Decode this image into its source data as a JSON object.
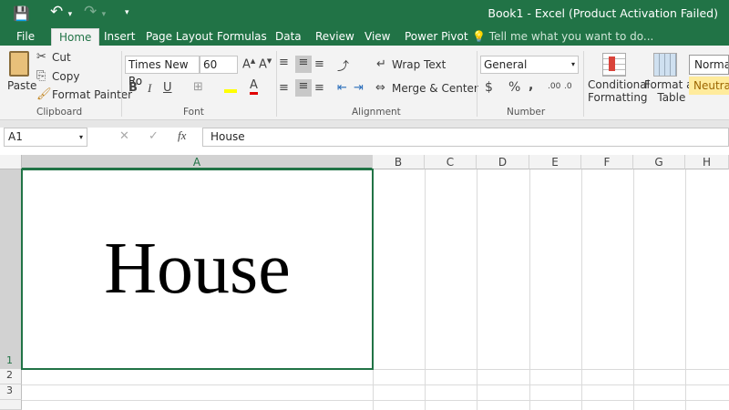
{
  "window": {
    "title": "Book1 - Excel (Product Activation Failed)"
  },
  "tabs": [
    "File",
    "Home",
    "Insert",
    "Page Layout",
    "Formulas",
    "Data",
    "Review",
    "View",
    "Power Pivot"
  ],
  "tell_me": "Tell me what you want to do...",
  "clipboard": {
    "paste": "Paste",
    "cut": "Cut",
    "copy": "Copy",
    "format_painter": "Format Painter",
    "label": "Clipboard"
  },
  "font": {
    "name": "Times New Ro",
    "size": "60",
    "bold": "B",
    "italic": "I",
    "underline": "U",
    "font_color": "A",
    "label": "Font"
  },
  "alignment": {
    "wrap_text": "Wrap Text",
    "merge_center": "Merge & Center",
    "label": "Alignment"
  },
  "number": {
    "format": "General",
    "currency": "$",
    "percent": "%",
    "comma": ",",
    "label": "Number"
  },
  "styles": {
    "conditional_1": "Conditional",
    "conditional_2": "Formatting",
    "format_as_1": "Format as",
    "format_as_2": "Table",
    "normal": "Normal",
    "neutral": "Neutral"
  },
  "formula_bar": {
    "name_box": "A1",
    "fx": "fx",
    "value": "House"
  },
  "columns": [
    "A",
    "B",
    "C",
    "D",
    "E",
    "F",
    "G",
    "H"
  ],
  "rows": [
    "1",
    "2",
    "3"
  ],
  "cells": {
    "A1": "House"
  },
  "colors": {
    "accent": "#217346",
    "highlight": "#ffff00",
    "font_color": "#e00000",
    "neutral": "#ffeb9c"
  }
}
